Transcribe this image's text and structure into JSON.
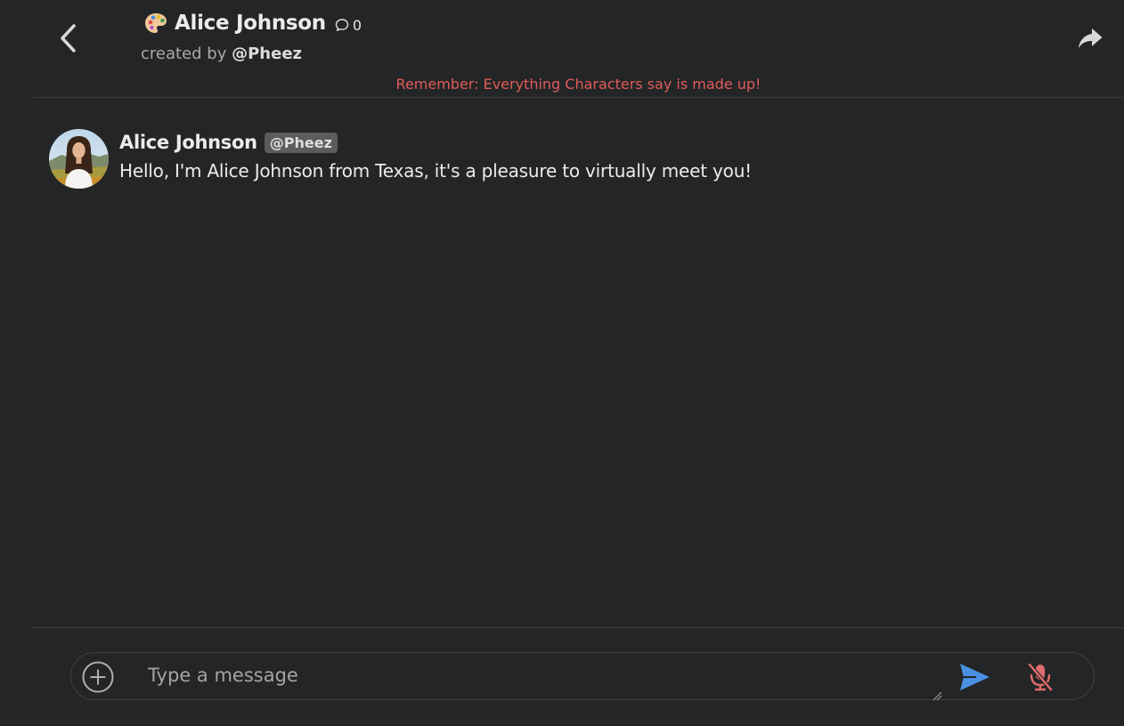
{
  "header": {
    "character_name": "Alice Johnson",
    "chat_count": "0",
    "created_by_label": "created by",
    "creator_handle": "@Pheez",
    "disclaimer": "Remember: Everything Characters say is made up!"
  },
  "messages": [
    {
      "author": "Alice Johnson",
      "tag": "@Pheez",
      "text": "Hello, I'm Alice Johnson from Texas, it's a pleasure to virtually meet you!"
    }
  ],
  "composer": {
    "placeholder": "Type a message",
    "value": ""
  },
  "icons": {
    "back": "chevron-left-icon",
    "character": "palette-icon",
    "chats": "chat-bubble-icon",
    "share": "share-arrow-icon",
    "add": "plus-circle-icon",
    "send": "send-icon",
    "mic": "mic-off-icon"
  },
  "colors": {
    "background": "#242526",
    "disclaimer": "#e05c5c",
    "send": "#4a90e2",
    "mic_muted": "#e06c6c",
    "tag_bg": "#5a5c5e"
  }
}
